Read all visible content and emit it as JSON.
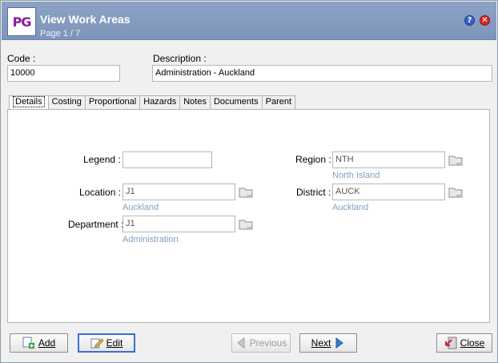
{
  "window": {
    "title": "View Work Areas",
    "subtitle": "Page 1 / 7",
    "logo_text": "PG",
    "help_glyph": "?",
    "close_glyph": "✕"
  },
  "header": {
    "code_label": "Code :",
    "code_value": "10000",
    "description_label": "Description :",
    "description_value": "Administration - Auckland"
  },
  "tabs": [
    {
      "label": "Details",
      "active": true
    },
    {
      "label": "Costing"
    },
    {
      "label": "Proportional"
    },
    {
      "label": "Hazards"
    },
    {
      "label": "Notes"
    },
    {
      "label": "Documents"
    },
    {
      "label": "Parent"
    }
  ],
  "details": {
    "legend_label": "Legend :",
    "legend_value": "",
    "location_label": "Location :",
    "location_value": "J1",
    "location_name": "Auckland",
    "department_label": "Department :",
    "department_value": "J1",
    "department_name": "Administration",
    "region_label": "Region :",
    "region_value": "NTH",
    "region_name": "North Island",
    "district_label": "District :",
    "district_value": "AUCK",
    "district_name": "Auckland"
  },
  "buttons": {
    "add": "Add",
    "edit": "Edit",
    "previous": "Previous",
    "next": "Next",
    "close": "Close"
  },
  "icons": {
    "browse": "folder-browse-icon",
    "add": "add-document-icon",
    "edit": "edit-pencil-icon",
    "previous": "arrow-left-icon",
    "next": "arrow-right-icon",
    "close": "close-door-icon"
  },
  "colors": {
    "titlebar": "#8da3c6",
    "link_text": "#7f9fbf",
    "focus_border": "#3a6fd0",
    "next_arrow": "#2f7fd6"
  }
}
